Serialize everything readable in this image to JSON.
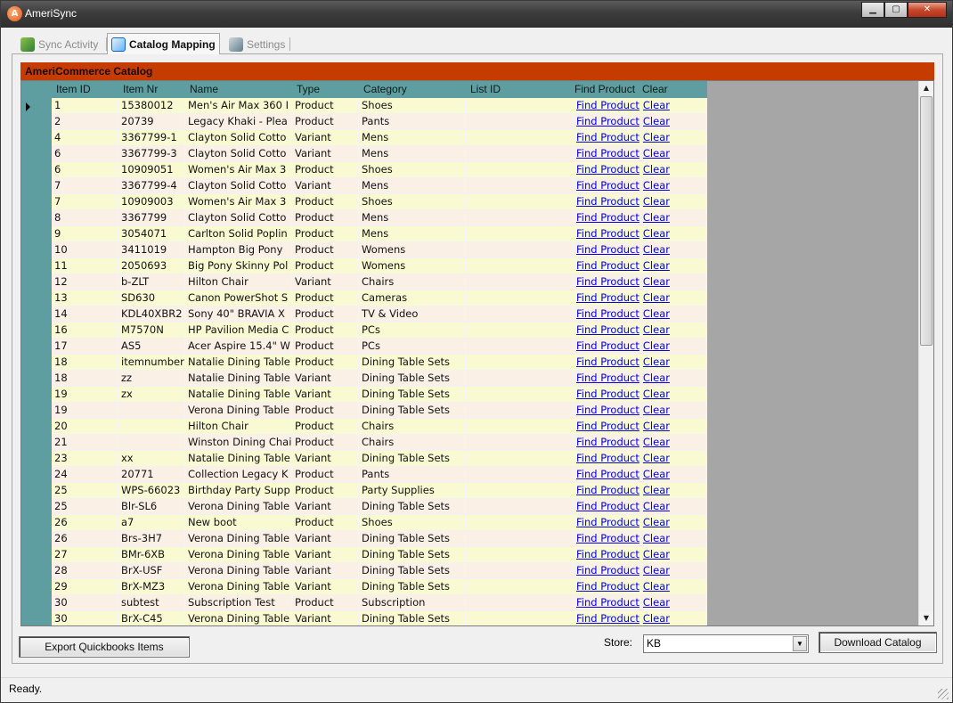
{
  "window": {
    "title": "AmeriSync",
    "minimize": "▁",
    "maximize": "▢",
    "close": "✕"
  },
  "tabs": [
    {
      "label": "Sync Activity",
      "active": false
    },
    {
      "label": "Catalog Mapping",
      "active": true
    },
    {
      "label": "Settings",
      "active": false
    }
  ],
  "catalog": {
    "title": "AmeriCommerce Catalog",
    "columns": [
      "Item ID",
      "Item Nr",
      "Name",
      "Type",
      "Category",
      "List ID",
      "Find Product",
      "Clear"
    ],
    "link_find": "Find Product",
    "link_clear": "Clear",
    "rows": [
      [
        "1",
        "15380012",
        "Men's Air Max 360 I",
        "Product",
        "Shoes",
        ""
      ],
      [
        "2",
        "20739",
        "Legacy Khaki - Plea",
        "Product",
        "Pants",
        ""
      ],
      [
        "4",
        "3367799-1",
        "Clayton Solid Cotto",
        "Variant",
        "Mens",
        ""
      ],
      [
        "6",
        "3367799-3",
        "Clayton Solid Cotto",
        "Variant",
        "Mens",
        ""
      ],
      [
        "6",
        "10909051",
        "Women's Air Max 3",
        "Product",
        "Shoes",
        ""
      ],
      [
        "7",
        "3367799-4",
        "Clayton Solid Cotto",
        "Variant",
        "Mens",
        ""
      ],
      [
        "7",
        "10909003",
        "Women's Air Max 3",
        "Product",
        "Shoes",
        ""
      ],
      [
        "8",
        "3367799",
        "Clayton Solid Cotto",
        "Product",
        "Mens",
        ""
      ],
      [
        "9",
        "3054071",
        "Carlton Solid Poplin",
        "Product",
        "Mens",
        ""
      ],
      [
        "10",
        "3411019",
        "Hampton Big Pony",
        "Product",
        "Womens",
        ""
      ],
      [
        "11",
        "2050693",
        "Big Pony Skinny Pol",
        "Product",
        "Womens",
        ""
      ],
      [
        "12",
        "b-ZLT",
        "Hilton Chair",
        "Variant",
        "Chairs",
        ""
      ],
      [
        "13",
        "SD630",
        "Canon PowerShot S",
        "Product",
        "Cameras",
        ""
      ],
      [
        "14",
        "KDL40XBR2",
        "Sony 40\" BRAVIA X",
        "Product",
        "TV & Video",
        ""
      ],
      [
        "16",
        "M7570N",
        "HP Pavilion Media C",
        "Product",
        "PCs",
        ""
      ],
      [
        "17",
        "AS5",
        "Acer Aspire 15.4\" W",
        "Product",
        "PCs",
        ""
      ],
      [
        "18",
        "itemnumber",
        "Natalie Dining Table",
        "Product",
        "Dining Table Sets",
        ""
      ],
      [
        "18",
        "zz",
        "Natalie Dining Table",
        "Variant",
        "Dining Table Sets",
        ""
      ],
      [
        "19",
        "zx",
        "Natalie Dining Table",
        "Variant",
        "Dining Table Sets",
        ""
      ],
      [
        "19",
        "",
        "Verona Dining Table",
        "Product",
        "Dining Table Sets",
        ""
      ],
      [
        "20",
        "",
        "Hilton Chair",
        "Product",
        "Chairs",
        ""
      ],
      [
        "21",
        "",
        "Winston Dining Chai",
        "Product",
        "Chairs",
        ""
      ],
      [
        "23",
        "xx",
        "Natalie Dining Table",
        "Variant",
        "Dining Table Sets",
        ""
      ],
      [
        "24",
        "20771",
        "Collection Legacy K",
        "Product",
        "Pants",
        ""
      ],
      [
        "25",
        "WPS-66023",
        "Birthday Party Supp",
        "Product",
        "Party Supplies",
        ""
      ],
      [
        "25",
        "Blr-SL6",
        "Verona Dining Table",
        "Variant",
        "Dining Table Sets",
        ""
      ],
      [
        "26",
        "a7",
        "New boot",
        "Product",
        "Shoes",
        ""
      ],
      [
        "26",
        "Brs-3H7",
        "Verona Dining Table",
        "Variant",
        "Dining Table Sets",
        ""
      ],
      [
        "27",
        "BMr-6XB",
        "Verona Dining Table",
        "Variant",
        "Dining Table Sets",
        ""
      ],
      [
        "28",
        "BrX-USF",
        "Verona Dining Table",
        "Variant",
        "Dining Table Sets",
        ""
      ],
      [
        "29",
        "BrX-MZ3",
        "Verona Dining Table",
        "Variant",
        "Dining Table Sets",
        ""
      ],
      [
        "30",
        "subtest",
        "Subscription Test",
        "Product",
        "Subscription",
        ""
      ],
      [
        "30",
        "BrX-C45",
        "Verona Dining Table",
        "Variant",
        "Dining Table Sets",
        ""
      ]
    ]
  },
  "controls": {
    "export_label": "Export Quickbooks Items",
    "store_label": "Store:",
    "store_value": "KB",
    "download_label": "Download Catalog"
  },
  "status": {
    "text": "Ready."
  }
}
